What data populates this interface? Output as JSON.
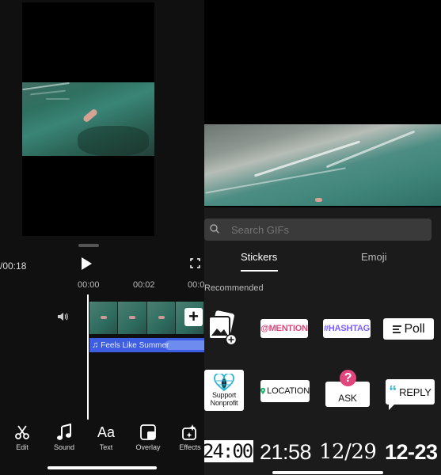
{
  "editor": {
    "timecode": "/00:18",
    "timeline_ticks": [
      "00:00",
      "00:02",
      "00:0"
    ],
    "audio_track_label": "Feels Like Summer",
    "tools": [
      {
        "icon": "scissors-icon",
        "label": "Edit"
      },
      {
        "icon": "music-note-icon",
        "label": "Sound"
      },
      {
        "icon": "text-icon",
        "label": "Text",
        "glyph": "Aa"
      },
      {
        "icon": "overlay-icon",
        "label": "Overlay"
      },
      {
        "icon": "effects-icon",
        "label": "Effects"
      }
    ]
  },
  "sticker_panel": {
    "search_placeholder": "Search GIFs",
    "tabs": [
      {
        "label": "Stickers",
        "active": true
      },
      {
        "label": "Emoji",
        "active": false
      }
    ],
    "section_title": "Recommended",
    "stickers": {
      "mention": "@MENTION",
      "hashtag": "#HASHTAG",
      "poll": "Poll",
      "support_line1": "Support",
      "support_line2": "Nonprofit",
      "location": "LOCATION",
      "ask_mark": "?",
      "ask": "ASK",
      "reply_quote": "“",
      "reply": "REPLY"
    },
    "clocks": [
      "24:00",
      "21:58",
      "12/29",
      "12-23"
    ]
  },
  "colors": {
    "audio_track": "#3d5ee0",
    "mention": "#e0457b",
    "hashtag": "#7a5cff",
    "location": "#1db36e",
    "ask": "#e0457b",
    "reply": "#2fb2d4"
  }
}
